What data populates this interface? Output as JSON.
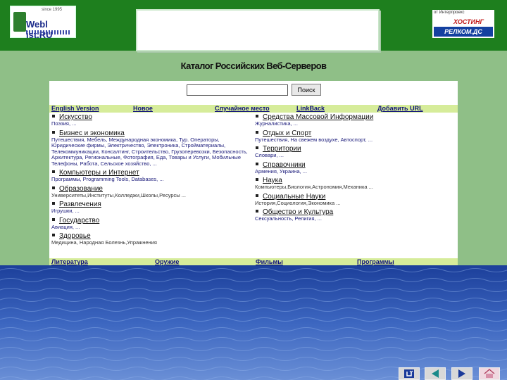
{
  "header": {
    "left_logo": {
      "since": "since 1995",
      "brand": "Webl ist.RU"
    },
    "right_logo": {
      "top_text": "от Интерпроекс",
      "hosting": "ХОСТИНГ",
      "relcom": "РЕЛКОМ.ДС"
    }
  },
  "page_title": "Каталог Российских Веб-Серверов",
  "search": {
    "value": "",
    "button_label": "Поиск"
  },
  "top_nav": [
    "English Version",
    "Новое",
    "Случайное место",
    "LinkBack",
    "Добавить URL"
  ],
  "left_column": [
    {
      "title": "Искусство",
      "sub": "Поэзия, ..."
    },
    {
      "title": "Бизнес и экономика",
      "sub": "Путешествия, Мебель, Международная экономика, Тур. Операторы, Юридические фирмы, Электричество, Электроника, Стройматериалы, Телекоммуникации, Консалтинг, Строительство, Грузоперевозки, Безопасность, Архитектура, Региональные, Фотография, Еда, Товары и Услуги, Мобильные Телефоны, Работа, Сельское хозяйство, ..."
    },
    {
      "title": "Компьютеры и Интернет",
      "sub": "Программы, Programming Tools, Databases, ..."
    },
    {
      "title": "Образование",
      "sub": "Университеты,Институты,Колледжи,Школы,Ресурсы ..."
    },
    {
      "title": "Развлечения",
      "sub": "Игрушки, ..."
    },
    {
      "title": "Государство",
      "sub": "Авиация, ..."
    },
    {
      "title": "Здоровье",
      "sub": "Медицина, Народная Болезнь,Упражнения"
    }
  ],
  "right_column": [
    {
      "title": "Средства Массовой Информации",
      "sub": "Журналистика, ..."
    },
    {
      "title": "Отдых и Спорт",
      "sub": "Путешествия, На свежем воздухе, Автоспорт, ..."
    },
    {
      "title": "Территории",
      "sub": "Словари, ..."
    },
    {
      "title": "Справочники",
      "sub": "Армения, Украина, ..."
    },
    {
      "title": "Наука",
      "sub": "Компьютеры,Биология,Астрономия,Механика ..."
    },
    {
      "title": "Социальные Науки",
      "sub": "История,Социология,Экономика ..."
    },
    {
      "title": "Общество и Культура",
      "sub": "Сексуальность, Религия, ..."
    }
  ],
  "bottom_nav": [
    "Литература",
    "Оружие",
    "Фильмы",
    "Программы"
  ],
  "slide_nav": {
    "icons": [
      "return-icon",
      "previous-icon",
      "next-icon",
      "home-icon"
    ]
  },
  "colors": {
    "header_green": "#1e7f1e",
    "page_green": "#8fbf87",
    "nav_bar": "#d6ec9a",
    "water_blue": "#1e44a0"
  }
}
